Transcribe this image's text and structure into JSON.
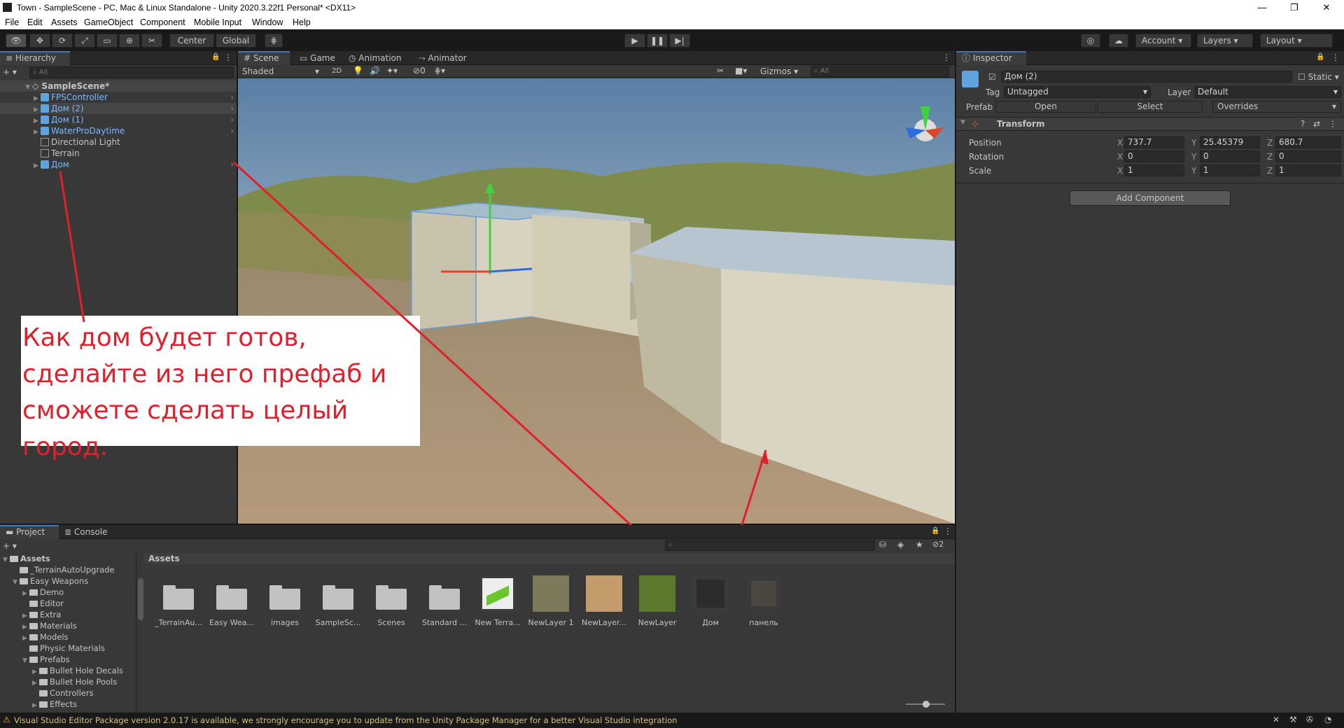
{
  "window": {
    "title": "Town - SampleScene - PC, Mac & Linux Standalone - Unity 2020.3.22f1 Personal* <DX11>",
    "minimize": "—",
    "maximize": "❐",
    "close": "✕"
  },
  "menu": [
    "File",
    "Edit",
    "Assets",
    "GameObject",
    "Component",
    "Mobile Input",
    "Window",
    "Help"
  ],
  "toolbar": {
    "center": "Center",
    "global": "Global",
    "account": "Account",
    "layers": "Layers",
    "layout": "Layout"
  },
  "hierarchy": {
    "tab": "Hierarchy",
    "search_placeholder": "All",
    "scene": "SampleScene*",
    "items": [
      {
        "name": "FPSController",
        "prefab": true
      },
      {
        "name": "Дом (2)",
        "prefab": true
      },
      {
        "name": "Дом (1)",
        "prefab": true
      },
      {
        "name": "WaterProDaytime",
        "prefab": true
      },
      {
        "name": "Directional Light",
        "prefab": false
      },
      {
        "name": "Terrain",
        "prefab": false
      },
      {
        "name": "Дом",
        "prefab": true
      }
    ]
  },
  "scene_view": {
    "tabs": [
      "Scene",
      "Game",
      "Animation",
      "Animator"
    ],
    "shading": "Shaded",
    "mode_2d": "2D",
    "hidden_count": "0",
    "gizmos": "Gizmos",
    "search_placeholder": "All",
    "annotation": "Как дом будет готов, сделайте из него префаб и сможете сделать целый город."
  },
  "inspector": {
    "tab": "Inspector",
    "object_name": "Дом (2)",
    "static": "Static",
    "tag_label": "Tag",
    "tag_value": "Untagged",
    "layer_label": "Layer",
    "layer_value": "Default",
    "prefab_label": "Prefab",
    "open": "Open",
    "select": "Select",
    "overrides": "Overrides",
    "transform": "Transform",
    "position_label": "Position",
    "rotation_label": "Rotation",
    "scale_label": "Scale",
    "position": {
      "x": "737.7",
      "y": "25.45379",
      "z": "680.7"
    },
    "rotation": {
      "x": "0",
      "y": "0",
      "z": "0"
    },
    "scale": {
      "x": "1",
      "y": "1",
      "z": "1"
    },
    "add_component": "Add Component"
  },
  "project": {
    "tabs": [
      "Project",
      "Console"
    ],
    "hidden_count": "2",
    "breadcrumb": "Assets",
    "tree": [
      {
        "label": "Assets",
        "level": 0,
        "open": true
      },
      {
        "label": "_TerrainAutoUpgrade",
        "level": 1,
        "open": null
      },
      {
        "label": "Easy Weapons",
        "level": 1,
        "open": true
      },
      {
        "label": "Demo",
        "level": 2,
        "open": false
      },
      {
        "label": "Editor",
        "level": 2,
        "open": null
      },
      {
        "label": "Extra",
        "level": 2,
        "open": false
      },
      {
        "label": "Materials",
        "level": 2,
        "open": false
      },
      {
        "label": "Models",
        "level": 2,
        "open": false
      },
      {
        "label": "Physic Materials",
        "level": 2,
        "open": null
      },
      {
        "label": "Prefabs",
        "level": 2,
        "open": true
      },
      {
        "label": "Bullet Hole Decals",
        "level": 3,
        "open": false
      },
      {
        "label": "Bullet Hole Pools",
        "level": 3,
        "open": false
      },
      {
        "label": "Controllers",
        "level": 3,
        "open": null
      },
      {
        "label": "Effects",
        "level": 3,
        "open": false
      }
    ],
    "assets": [
      {
        "label": "_TerrainAu...",
        "kind": "folder"
      },
      {
        "label": "Easy Wea...",
        "kind": "folder"
      },
      {
        "label": "images",
        "kind": "folder"
      },
      {
        "label": "SampleSc...",
        "kind": "folder"
      },
      {
        "label": "Scenes",
        "kind": "folder"
      },
      {
        "label": "Standard ...",
        "kind": "folder"
      },
      {
        "label": "New Terra...",
        "kind": "terrain"
      },
      {
        "label": "NewLayer 1",
        "kind": "layer1"
      },
      {
        "label": "NewLayer...",
        "kind": "layer2"
      },
      {
        "label": "NewLayer",
        "kind": "layer3"
      },
      {
        "label": "Дом",
        "kind": "prefab-dom"
      },
      {
        "label": "панель",
        "kind": "prefab-panel"
      }
    ]
  },
  "status_bar": {
    "message": "Visual Studio Editor Package version 2.0.17 is available, we strongly encourage you to update from the Unity Package Manager for a better Visual Studio integration"
  }
}
